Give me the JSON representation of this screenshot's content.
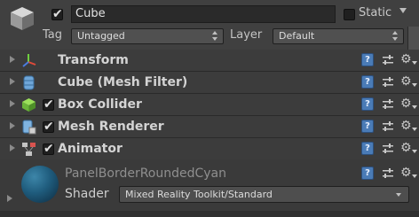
{
  "header": {
    "active_checked": true,
    "object_name": "Cube",
    "static_label": "Static",
    "tag_label": "Tag",
    "tag_value": "Untagged",
    "layer_label": "Layer",
    "layer_value": "Default"
  },
  "components": [
    {
      "title": "Transform",
      "icon": "transform-axes-icon",
      "has_checkbox": false
    },
    {
      "title": "Cube (Mesh Filter)",
      "icon": "mesh-filter-icon",
      "has_checkbox": false
    },
    {
      "title": "Box Collider",
      "icon": "box-collider-icon",
      "has_checkbox": true,
      "checked": true
    },
    {
      "title": "Mesh Renderer",
      "icon": "mesh-renderer-icon",
      "has_checkbox": true,
      "checked": true
    },
    {
      "title": "Animator",
      "icon": "animator-icon",
      "has_checkbox": true,
      "checked": true
    }
  ],
  "material": {
    "name": "PanelBorderRoundedCyan",
    "shader_label": "Shader",
    "shader_value": "Mixed Reality Toolkit/Standard"
  },
  "colors": {
    "panel_bg": "#3a3a3a",
    "help_blue": "#4a7bb6",
    "preview_cyan": "#1f5c7d"
  }
}
